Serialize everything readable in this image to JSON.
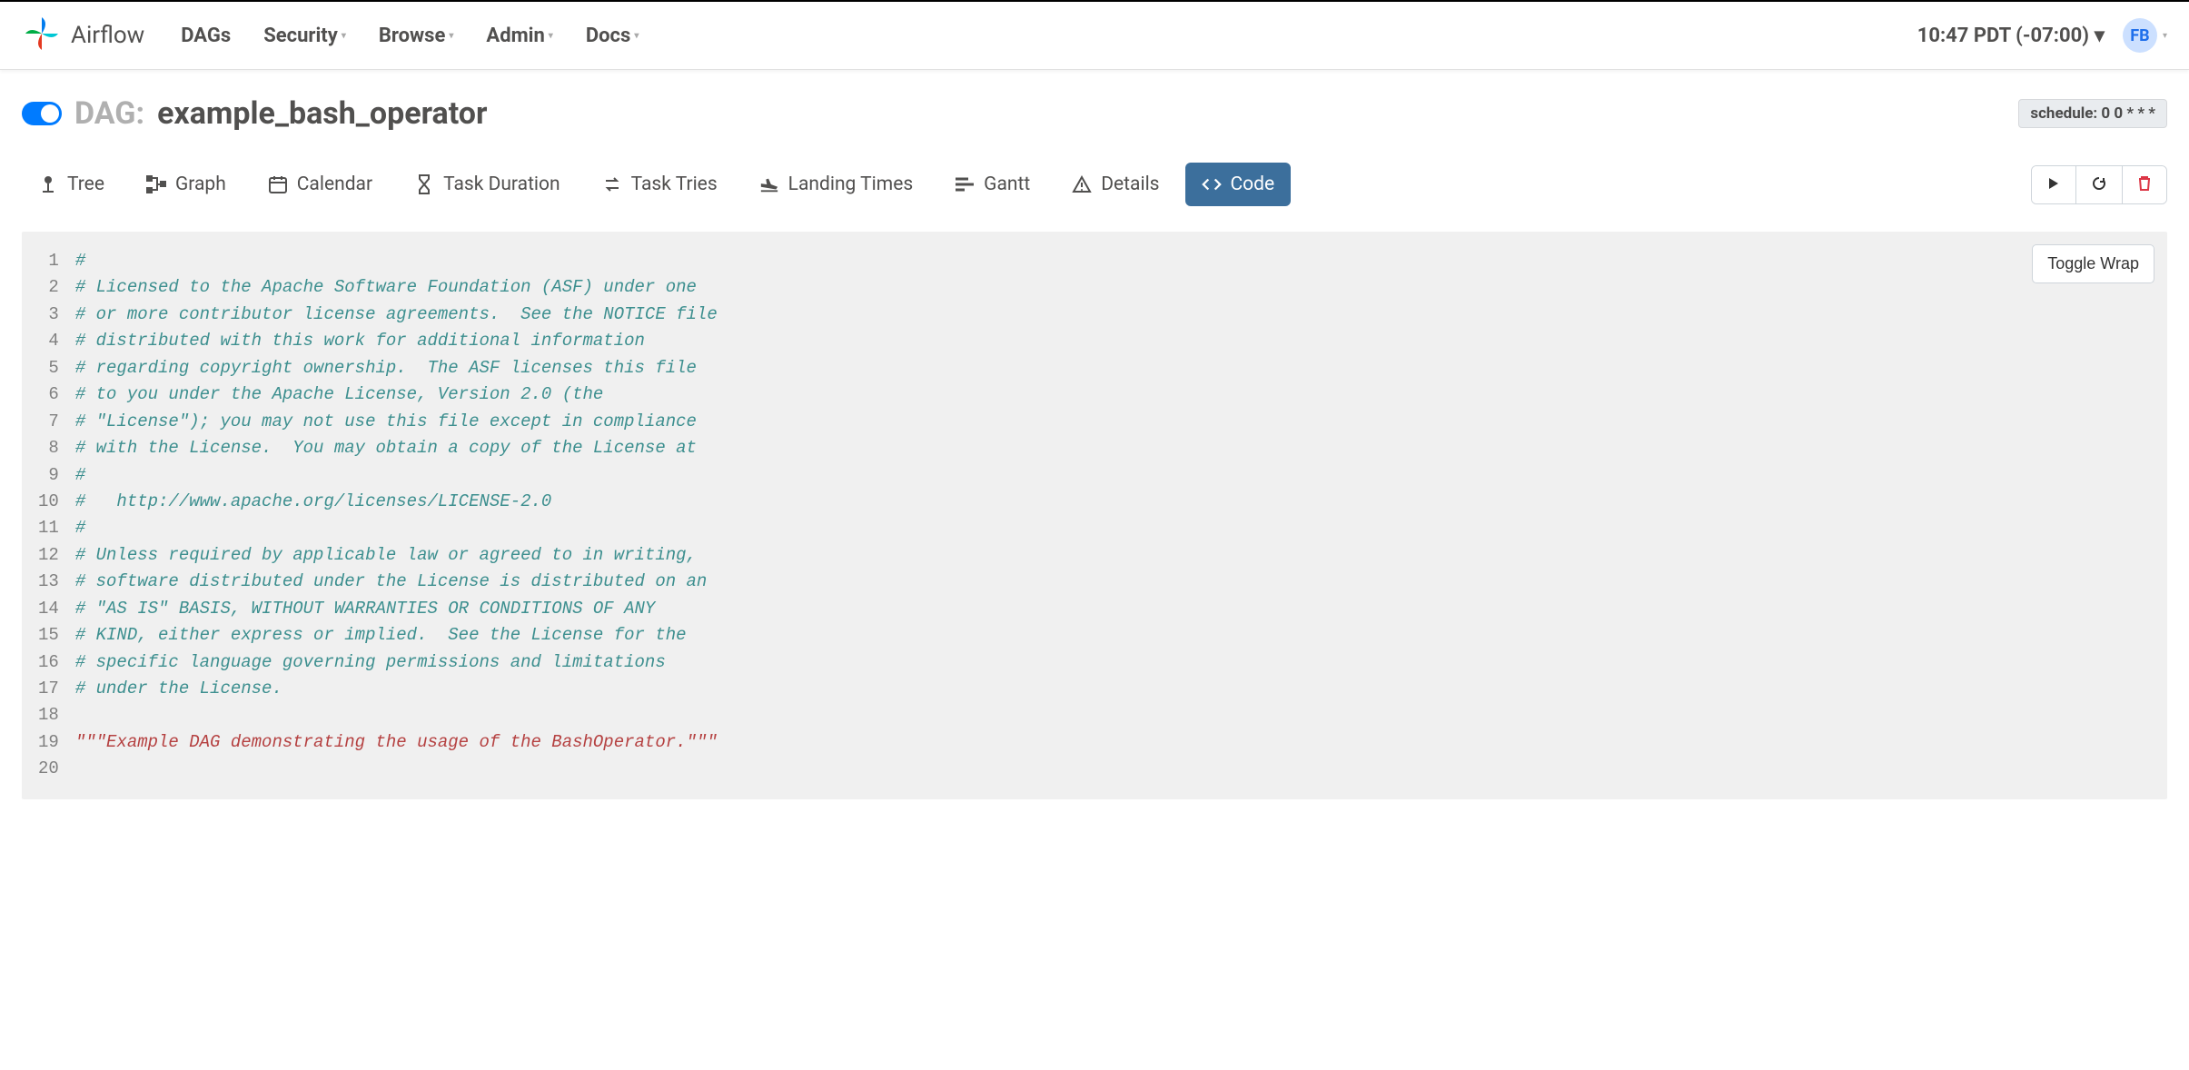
{
  "brand": {
    "name": "Airflow"
  },
  "nav": {
    "items": [
      {
        "label": "DAGs",
        "has_caret": false
      },
      {
        "label": "Security",
        "has_caret": true
      },
      {
        "label": "Browse",
        "has_caret": true
      },
      {
        "label": "Admin",
        "has_caret": true
      },
      {
        "label": "Docs",
        "has_caret": true
      }
    ],
    "clock": "10:47 PDT (-07:00)",
    "user_initials": "FB"
  },
  "dag": {
    "prefix": "DAG:",
    "name": "example_bash_operator",
    "schedule_label": "schedule: 0 0 * * *"
  },
  "tabs": [
    {
      "label": "Tree",
      "icon": "tree-icon"
    },
    {
      "label": "Graph",
      "icon": "graph-icon"
    },
    {
      "label": "Calendar",
      "icon": "calendar-icon"
    },
    {
      "label": "Task Duration",
      "icon": "hourglass-icon"
    },
    {
      "label": "Task Tries",
      "icon": "retry-icon"
    },
    {
      "label": "Landing Times",
      "icon": "landing-icon"
    },
    {
      "label": "Gantt",
      "icon": "gantt-icon"
    },
    {
      "label": "Details",
      "icon": "details-icon"
    },
    {
      "label": "Code",
      "icon": "code-icon",
      "active": true
    }
  ],
  "buttons": {
    "toggle_wrap": "Toggle Wrap"
  },
  "code_lines": [
    {
      "n": 1,
      "cls": "c",
      "text": "#"
    },
    {
      "n": 2,
      "cls": "c",
      "text": "# Licensed to the Apache Software Foundation (ASF) under one"
    },
    {
      "n": 3,
      "cls": "c",
      "text": "# or more contributor license agreements.  See the NOTICE file"
    },
    {
      "n": 4,
      "cls": "c",
      "text": "# distributed with this work for additional information"
    },
    {
      "n": 5,
      "cls": "c",
      "text": "# regarding copyright ownership.  The ASF licenses this file"
    },
    {
      "n": 6,
      "cls": "c",
      "text": "# to you under the Apache License, Version 2.0 (the"
    },
    {
      "n": 7,
      "cls": "c",
      "text": "# \"License\"); you may not use this file except in compliance"
    },
    {
      "n": 8,
      "cls": "c",
      "text": "# with the License.  You may obtain a copy of the License at"
    },
    {
      "n": 9,
      "cls": "c",
      "text": "#"
    },
    {
      "n": 10,
      "cls": "c",
      "text": "#   http://www.apache.org/licenses/LICENSE-2.0"
    },
    {
      "n": 11,
      "cls": "c",
      "text": "#"
    },
    {
      "n": 12,
      "cls": "c",
      "text": "# Unless required by applicable law or agreed to in writing,"
    },
    {
      "n": 13,
      "cls": "c",
      "text": "# software distributed under the License is distributed on an"
    },
    {
      "n": 14,
      "cls": "c",
      "text": "# \"AS IS\" BASIS, WITHOUT WARRANTIES OR CONDITIONS OF ANY"
    },
    {
      "n": 15,
      "cls": "c",
      "text": "# KIND, either express or implied.  See the License for the"
    },
    {
      "n": 16,
      "cls": "c",
      "text": "# specific language governing permissions and limitations"
    },
    {
      "n": 17,
      "cls": "c",
      "text": "# under the License."
    },
    {
      "n": 18,
      "cls": "",
      "text": ""
    },
    {
      "n": 19,
      "cls": "d",
      "text": "\"\"\"Example DAG demonstrating the usage of the BashOperator.\"\"\""
    },
    {
      "n": 20,
      "cls": "",
      "text": ""
    }
  ]
}
